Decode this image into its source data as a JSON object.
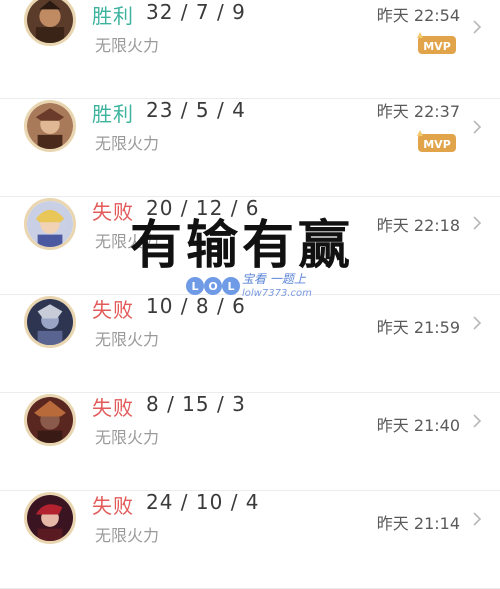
{
  "matches": [
    {
      "result": "胜利",
      "kda": "32 / 7 / 9",
      "mode": "无限火力",
      "time": "昨天 22:54",
      "mvp": true,
      "status": "win"
    },
    {
      "result": "胜利",
      "kda": "23 / 5 / 4",
      "mode": "无限火力",
      "time": "昨天 22:37",
      "mvp": true,
      "status": "win"
    },
    {
      "result": "失败",
      "kda": "20 / 12 / 6",
      "mode": "无限火力",
      "time": "昨天 22:18",
      "mvp": false,
      "status": "loss"
    },
    {
      "result": "失败",
      "kda": "10 / 8 / 6",
      "mode": "无限火力",
      "time": "昨天 21:59",
      "mvp": false,
      "status": "loss"
    },
    {
      "result": "失败",
      "kda": "8 / 15 / 3",
      "mode": "无限火力",
      "time": "昨天 21:40",
      "mvp": false,
      "status": "loss"
    },
    {
      "result": "失败",
      "kda": "24 / 10 / 4",
      "mode": "无限火力",
      "time": "昨天 21:14",
      "mvp": false,
      "status": "loss"
    }
  ],
  "badge_label": "MVP",
  "overlay_caption": "有输有赢",
  "watermark": {
    "logo_text": "LOL",
    "line1": "宝看 一题上",
    "line2": "lolw7373.com"
  },
  "colors": {
    "win": "#3db39e",
    "loss": "#e35a5a",
    "mvp_badge": "#e2a44a"
  }
}
